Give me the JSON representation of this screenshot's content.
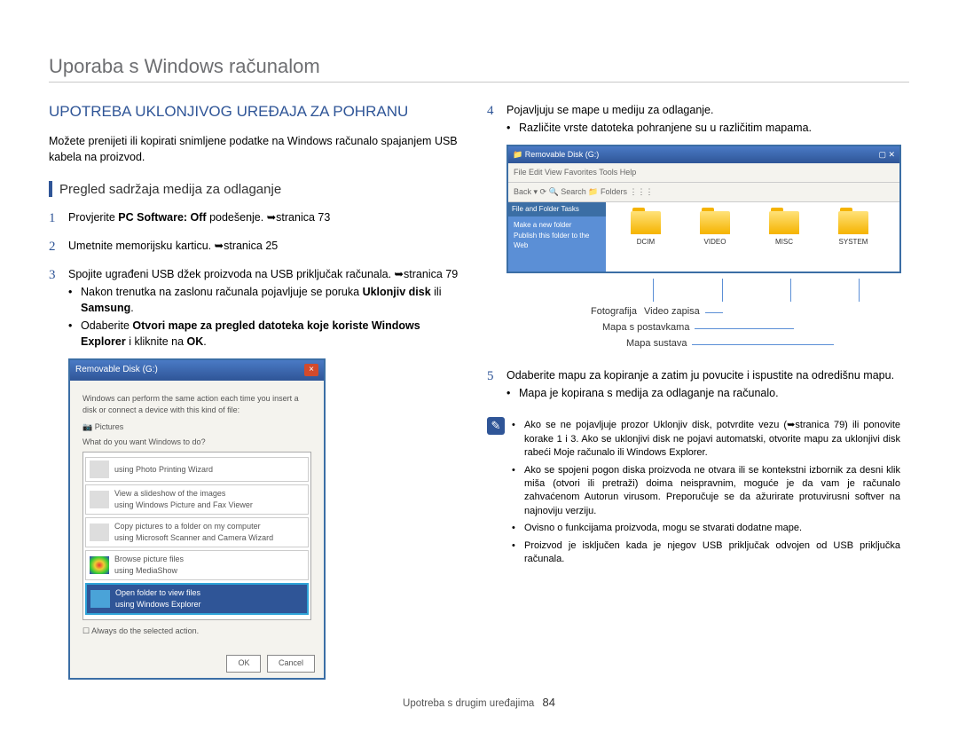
{
  "title": "Uporaba s Windows računalom",
  "section_head": "UPOTREBA UKLONJIVOG UREĐAJA ZA POHRANU",
  "intro": "Možete prenijeti ili kopirati snimljene podatke na Windows računalo spajanjem USB kabela na proizvod.",
  "subhead": "Pregled sadržaja medija za odlaganje",
  "steps_left": [
    {
      "num": "1",
      "parts": [
        "Provjerite ",
        "PC Software: Off",
        " podešenje. ➥stranica 73"
      ]
    },
    {
      "num": "2",
      "parts": [
        "Umetnite memorijsku karticu. ➥stranica 25"
      ]
    },
    {
      "num": "3",
      "parts": [
        "Spojite ugrađeni USB džek proizvoda na USB priključak računala. ➥stranica 79"
      ],
      "bullets": [
        {
          "pre": "Nakon trenutka na zaslonu računala pojavljuje se poruka ",
          "bold": "Uklonjiv disk",
          "mid": " ili ",
          "bold2": "Samsung",
          "post": "."
        },
        {
          "pre": "Odaberite ",
          "bold": "Otvori mape za pregled datoteka koje koriste Windows Explorer",
          "post": " i kliknite na ",
          "bold2": "OK",
          "tail": "."
        }
      ]
    }
  ],
  "dialog": {
    "title": "Removable Disk (G:)",
    "line1": "Windows can perform the same action each time you insert a disk or connect a device with this kind of file:",
    "pictures": "Pictures",
    "prompt": "What do you want Windows to do?",
    "opts": [
      {
        "l1": "using Photo Printing Wizard"
      },
      {
        "l1": "View a slideshow of the images",
        "l2": "using Windows Picture and Fax Viewer"
      },
      {
        "l1": "Copy pictures to a folder on my computer",
        "l2": "using Microsoft Scanner and Camera Wizard"
      },
      {
        "l1": "Browse picture files",
        "l2": "using MediaShow"
      },
      {
        "l1": "Open folder to view files",
        "l2": "using Windows Explorer",
        "hl": true
      }
    ],
    "always": "Always do the selected action.",
    "ok": "OK",
    "cancel": "Cancel"
  },
  "steps_right": [
    {
      "num": "4",
      "text": "Pojavljuju se mape u mediju za odlaganje.",
      "bullets": [
        "Različite vrste datoteka pohranjene su u različitim mapama."
      ]
    },
    {
      "num": "5",
      "text": "Odaberite mapu za kopiranje a zatim ju povucite i ispustite na odredišnu mapu.",
      "bullets": [
        "Mapa je kopirana s medija za odlaganje na računalo."
      ]
    }
  ],
  "explorer": {
    "title": "Removable Disk (G:)",
    "menu": "File  Edit  View  Favorites  Tools  Help",
    "toolbar": "Back  ▾  ⟳  🔍 Search  📁 Folders  ⋮⋮⋮",
    "side_head": "File and Folder Tasks",
    "side1": "Make a new folder",
    "side2": "Publish this folder to the Web",
    "folders": [
      "DCIM",
      "VIDEO",
      "MISC",
      "SYSTEM"
    ]
  },
  "callouts": {
    "c1": "Fotografija",
    "c2": "Video zapisa",
    "c3": "Mapa s postavkama",
    "c4": "Mapa sustava"
  },
  "notes": [
    "Ako se ne pojavljuje prozor Uklonjiv disk, potvrdite vezu (➥stranica 79) ili ponovite korake 1 i 3. Ako se uklonjivi disk ne pojavi automatski, otvorite mapu za uklonjivi disk rabeći Moje računalo ili Windows Explorer.",
    "Ako se spojeni pogon diska proizvoda ne otvara ili se kontekstni izbornik za desni klik miša (otvori ili pretraži) doima neispravnim, moguće je da vam je računalo zahvaćenom Autorun virusom. Preporučuje se da ažurirate protuvirusni softver na najnoviju verziju.",
    "Ovisno o funkcijama proizvoda, mogu se stvarati dodatne mape.",
    "Proizvod je isključen kada je njegov USB priključak odvojen od USB priključka računala."
  ],
  "footer": {
    "section": "Upotreba s drugim uređajima",
    "page": "84"
  }
}
